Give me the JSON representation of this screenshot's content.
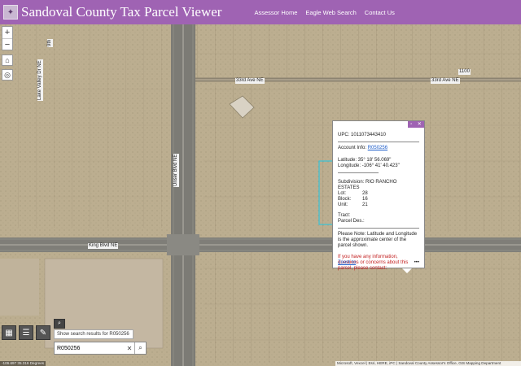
{
  "header": {
    "title": "Sandoval County Tax Parcel Viewer",
    "nav": [
      "Assessor Home",
      "Eagle Web Search",
      "Contact Us"
    ]
  },
  "controls": {
    "zoom_in": "+",
    "zoom_out": "−"
  },
  "roads": {
    "upper_left_vertical": "Lake Valley Dr NE",
    "upper_left_short": "9th",
    "unser": "Unser Blvd NE",
    "ave_33rd_left": "33rd Ave NE",
    "ave_33rd_right": "33rd Ave NE",
    "king": "King Blvd NE",
    "corner_tag": "1100"
  },
  "popup": {
    "upc": "UPC: 1011073443410",
    "account_label": "Account Info:",
    "account_link": "R050256",
    "latitude": "Latitude: 35° 18' 56.069\"",
    "longitude": "Longitude: -106° 41' 40.423\"",
    "subdivision": "Subdivision: RIO RANCHO ESTATES",
    "fields": [
      {
        "k": "Lot:",
        "v": "28"
      },
      {
        "k": "Block:",
        "v": "16"
      },
      {
        "k": "Unit:",
        "v": "21"
      }
    ],
    "tract": "Tract:",
    "parcel_des": "Parcel Des.:",
    "note": "Please Note: Latitude and Longitude is the approximate center of the parcel shown.",
    "contact": "If you have any information, questions or concerns about this parcel, please contact:",
    "zoom_to": "Zoom to",
    "more": "•••"
  },
  "search": {
    "tooltip": "Show search results for R050256",
    "value": "R050256"
  },
  "footer": {
    "coordinates": "-106.697 35.316 Degrees",
    "attribution": "Microsoft, Vexcel | Esri, HERE, iPC | Sandoval County Assessor's Office, GIS Mapping Department"
  }
}
